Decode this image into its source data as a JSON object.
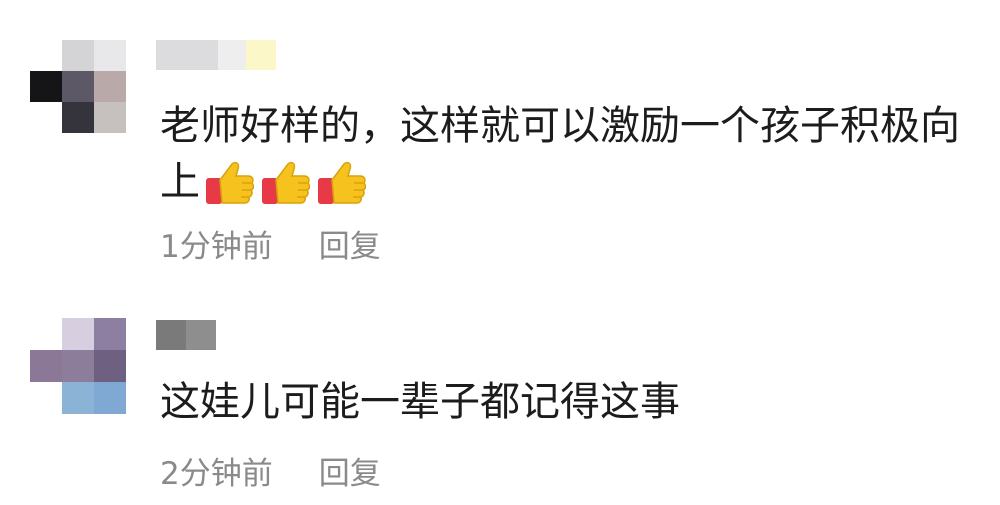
{
  "comments": [
    {
      "text": "老师好样的，这样就可以激励一个孩子积极向上",
      "emoji": [
        "thumbs-up-icon",
        "thumbs-up-icon",
        "thumbs-up-icon"
      ],
      "time": "1分钟前",
      "reply_label": "回复",
      "avatar_colors": [
        "#ffffff",
        "#d4d4d6",
        "#e8e8ea",
        "#151517",
        "#5d5865",
        "#b9a9a8",
        "#ffffff",
        "#35333c",
        "#c6c0bf"
      ],
      "username_colors": [
        "#dcdcde",
        "#eeeeee",
        "#fcf7c8"
      ]
    },
    {
      "text": "这娃儿可能一辈子都记得这事",
      "time": "2分钟前",
      "reply_label": "回复",
      "avatar_colors": [
        "#ffffff",
        "#d7cfe0",
        "#8d7fa1",
        "#8a7896",
        "#8c7d9b",
        "#6e6080",
        "#ffffff",
        "#8ab3d6",
        "#7fa9d3"
      ],
      "username_colors": [
        "#7a7a7a",
        "#8e8e8e"
      ]
    }
  ]
}
